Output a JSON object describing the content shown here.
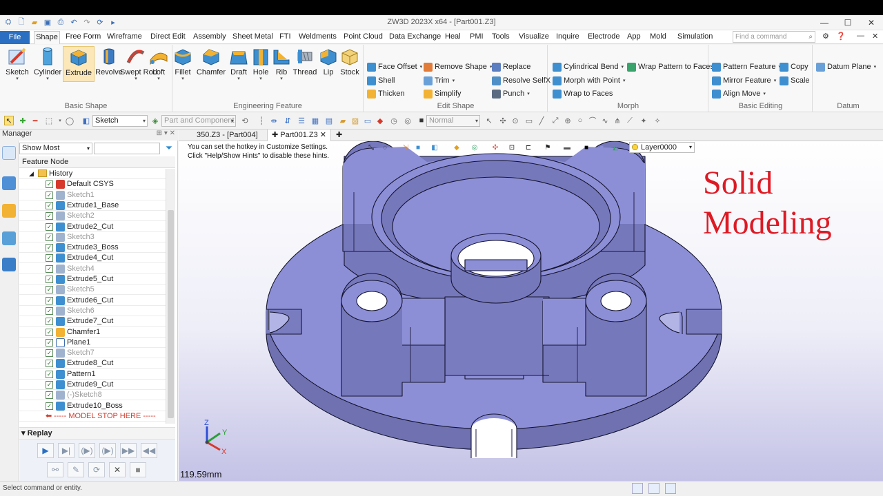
{
  "window": {
    "title": "ZW3D 2023X x64 - [Part001.Z3]"
  },
  "menu": {
    "file": "File",
    "tabs": [
      "Shape",
      "Free Form",
      "Wireframe",
      "Direct Edit",
      "Assembly",
      "Sheet Metal",
      "FTI",
      "Weldments",
      "Point Cloud",
      "Data Exchange",
      "Heal",
      "PMI",
      "Tools",
      "Visualize",
      "Inquire",
      "Electrode",
      "App",
      "Mold",
      "Simulation"
    ],
    "search_placeholder": "Find a command"
  },
  "ribbon": {
    "basic_shape": {
      "label": "Basic Shape",
      "buttons": [
        "Sketch",
        "Cylinder",
        "Extrude",
        "Revolve",
        "Swept Rod",
        "Loft"
      ]
    },
    "engineering_feature": {
      "label": "Engineering Feature",
      "buttons": [
        "Fillet",
        "Chamfer",
        "Draft",
        "Hole",
        "Rib",
        "Thread",
        "Lip",
        "Stock"
      ]
    },
    "edit_shape": {
      "label": "Edit Shape",
      "items": [
        "Face Offset",
        "Remove Shape",
        "Replace",
        "Shell",
        "Trim",
        "Resolve SelfX",
        "Thicken",
        "Simplify",
        "Punch"
      ]
    },
    "morph": {
      "label": "Morph",
      "items": [
        "Cylindrical Bend",
        "Wrap Pattern to Faces",
        "Morph with Point",
        "Wrap to Faces"
      ]
    },
    "basic_editing": {
      "label": "Basic Editing",
      "items": [
        "Pattern Feature",
        "Copy",
        "Mirror Feature",
        "Scale",
        "Align Move"
      ]
    },
    "datum": {
      "label": "Datum",
      "items": [
        "Datum Plane"
      ]
    }
  },
  "toolbar2": {
    "filter": "Sketch",
    "scope": "Part and Component",
    "mode": "Normal"
  },
  "manager": {
    "title": "Manager",
    "show": "Show Most",
    "column_header": "Feature Node",
    "history_label": "History",
    "nodes": [
      {
        "label": "Default CSYS",
        "type": "csys",
        "dim": false
      },
      {
        "label": "Sketch1",
        "type": "sketch",
        "dim": true
      },
      {
        "label": "Extrude1_Base",
        "type": "feature",
        "dim": false
      },
      {
        "label": "Sketch2",
        "type": "sketch",
        "dim": true
      },
      {
        "label": "Extrude2_Cut",
        "type": "feature",
        "dim": false
      },
      {
        "label": "Sketch3",
        "type": "sketch",
        "dim": true
      },
      {
        "label": "Extrude3_Boss",
        "type": "feature",
        "dim": false
      },
      {
        "label": "Extrude4_Cut",
        "type": "feature",
        "dim": false
      },
      {
        "label": "Sketch4",
        "type": "sketch",
        "dim": true
      },
      {
        "label": "Extrude5_Cut",
        "type": "feature",
        "dim": false
      },
      {
        "label": "Sketch5",
        "type": "sketch",
        "dim": true
      },
      {
        "label": "Extrude6_Cut",
        "type": "feature",
        "dim": false
      },
      {
        "label": "Sketch6",
        "type": "sketch",
        "dim": true
      },
      {
        "label": "Extrude7_Cut",
        "type": "feature",
        "dim": false
      },
      {
        "label": "Chamfer1",
        "type": "chamfer",
        "dim": false
      },
      {
        "label": "Plane1",
        "type": "plane",
        "dim": false
      },
      {
        "label": "Sketch7",
        "type": "sketch",
        "dim": true
      },
      {
        "label": "Extrude8_Cut",
        "type": "feature",
        "dim": false
      },
      {
        "label": "Pattern1",
        "type": "feature",
        "dim": false
      },
      {
        "label": "Extrude9_Cut",
        "type": "feature",
        "dim": false
      },
      {
        "label": "(-)Sketch8",
        "type": "sketch",
        "dim": true
      },
      {
        "label": "Extrude10_Boss",
        "type": "feature",
        "dim": false
      }
    ],
    "stop_label": "----- MODEL STOP HERE -----",
    "replay_label": "Replay"
  },
  "doc_tabs": [
    "350.Z3 - [Part004]",
    "Part001.Z3"
  ],
  "viewport": {
    "hint_line1": "You can set the hotkey in Customize Settings.",
    "hint_line2": "Click \"Help/Show Hints\" to disable these hints.",
    "overlay_line1": "Solid",
    "overlay_line2": "Modeling",
    "dimension": "119.59mm",
    "layer": "Layer0000",
    "axes": {
      "x": "X",
      "y": "Y",
      "z": "Z"
    }
  },
  "status": {
    "text": "Select command or entity."
  },
  "colors": {
    "model": "#8c8fd6",
    "accent": "#2b6fc3",
    "overlay_text": "#dd1a24"
  }
}
